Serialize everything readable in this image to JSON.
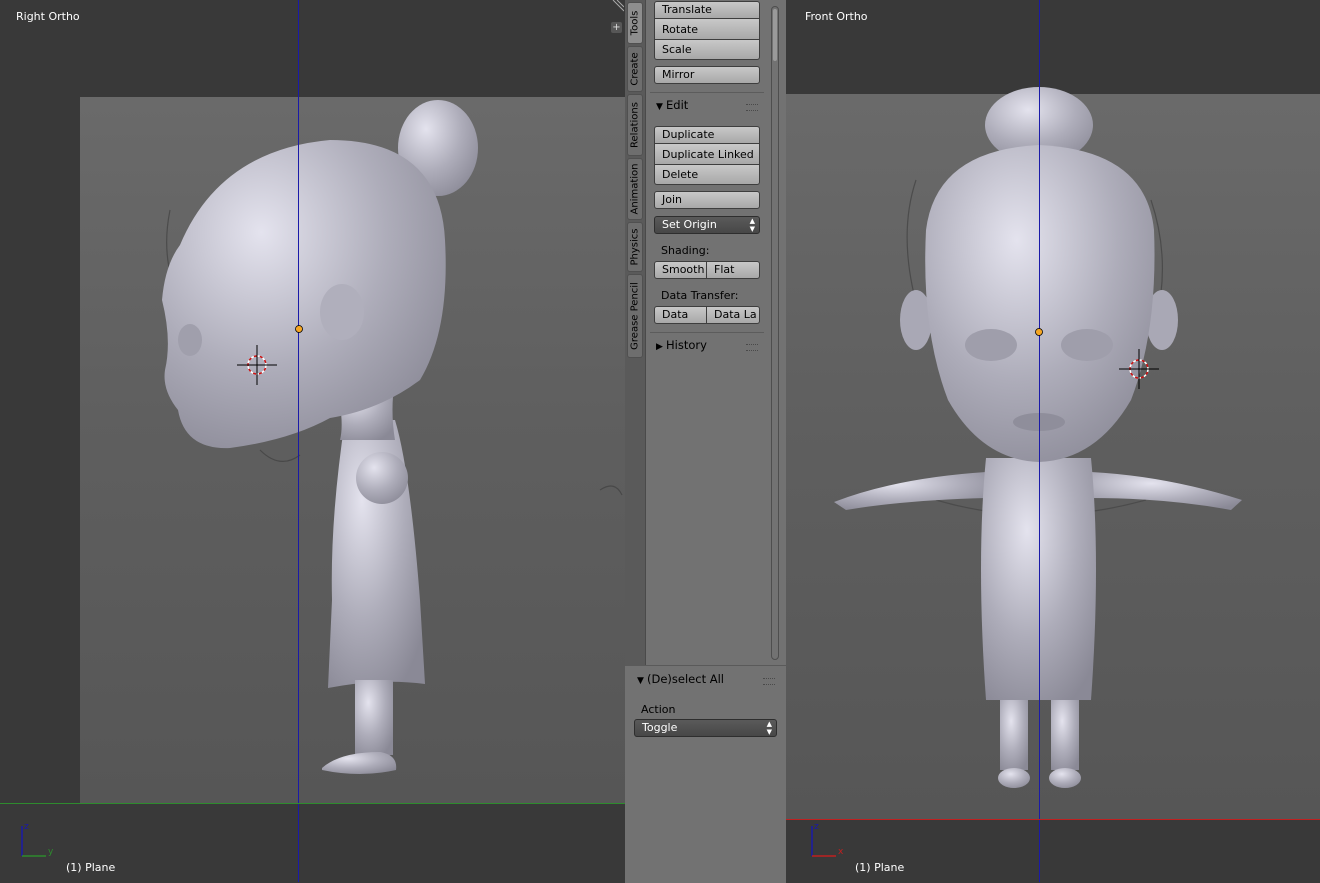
{
  "left_viewport": {
    "view_name": "Right Ortho",
    "object_label": "(1) Plane"
  },
  "right_viewport": {
    "view_name": "Front Ortho",
    "object_label": "(1) Plane"
  },
  "toolshelf": {
    "tabs": [
      "Tools",
      "Create",
      "Relations",
      "Animation",
      "Physics",
      "Grease Pencil"
    ],
    "transform_buttons": [
      "Translate",
      "Rotate",
      "Scale"
    ],
    "mirror": "Mirror",
    "edit_header": "Edit",
    "edit_buttons": [
      "Duplicate",
      "Duplicate Linked",
      "Delete"
    ],
    "join": "Join",
    "set_origin": "Set Origin",
    "shading_label": "Shading:",
    "shading_buttons": [
      "Smooth",
      "Flat"
    ],
    "data_transfer_label": "Data Transfer:",
    "data_transfer_buttons": [
      "Data",
      "Data La"
    ],
    "history_header": "History"
  },
  "redo_panel": {
    "header": "(De)select All",
    "action_label": "Action",
    "action_value": "Toggle"
  },
  "colors": {
    "viewport_bg": "#393939",
    "shelf_bg": "#727272",
    "y_axis": "#2e8b2e",
    "x_axis": "#c02020",
    "z_axis": "#1a1aa8",
    "origin_dot": "#f5a623"
  }
}
